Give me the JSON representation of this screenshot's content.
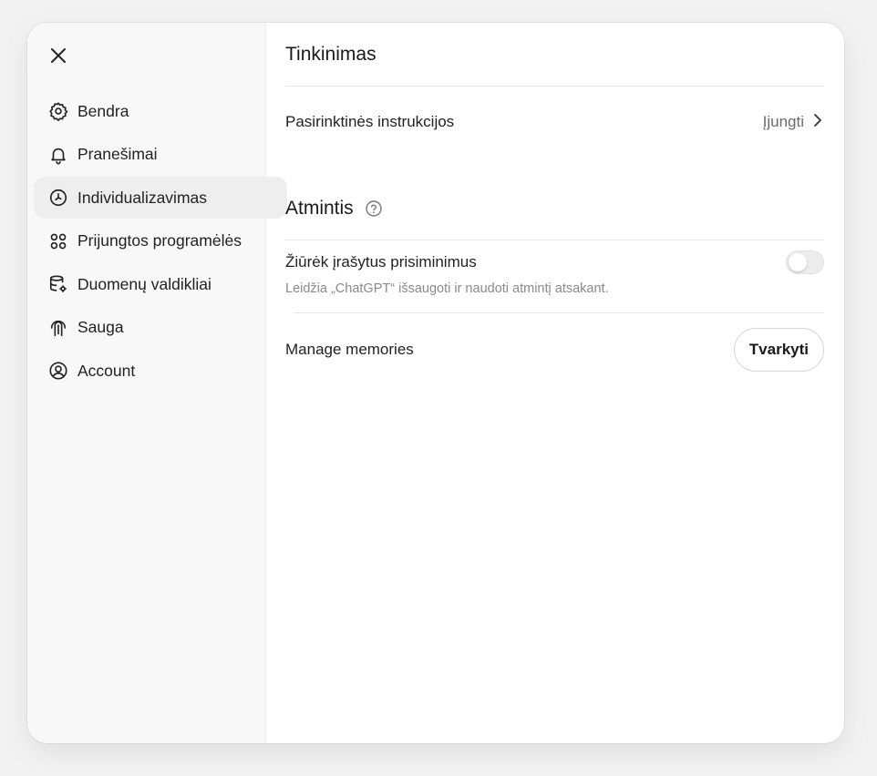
{
  "sidebar": {
    "close_icon": "close-icon",
    "items": [
      {
        "label": "Bendra",
        "icon": "gear-icon"
      },
      {
        "label": "Pranešimai",
        "icon": "bell-icon"
      },
      {
        "label": "Individualizavimas",
        "icon": "personalization-icon",
        "active": true
      },
      {
        "label": "Prijungtos programėlės",
        "icon": "apps-icon"
      },
      {
        "label": "Duomenų valdikliai",
        "icon": "database-settings-icon"
      },
      {
        "label": "Sauga",
        "icon": "security-icon"
      },
      {
        "label": "Account",
        "icon": "account-icon"
      }
    ]
  },
  "main": {
    "customization": {
      "title": "Tinkinimas",
      "custom_instructions_label": "Pasirinktinės instrukcijos",
      "custom_instructions_value": "Įjungti"
    },
    "memory": {
      "title": "Atmintis",
      "reference_label": "Žiūrėk įrašytus prisiminimus",
      "reference_description": "Leidžia „ChatGPT“ išsaugoti ir naudoti atmintį atsakant.",
      "reference_enabled": false,
      "manage_label": "Manage memories",
      "manage_button": "Tvarkyti"
    }
  },
  "colors": {
    "page_background": "#f3f2f3",
    "sidebar_background": "#f9f8f9",
    "active_item_background": "#efeeef"
  }
}
